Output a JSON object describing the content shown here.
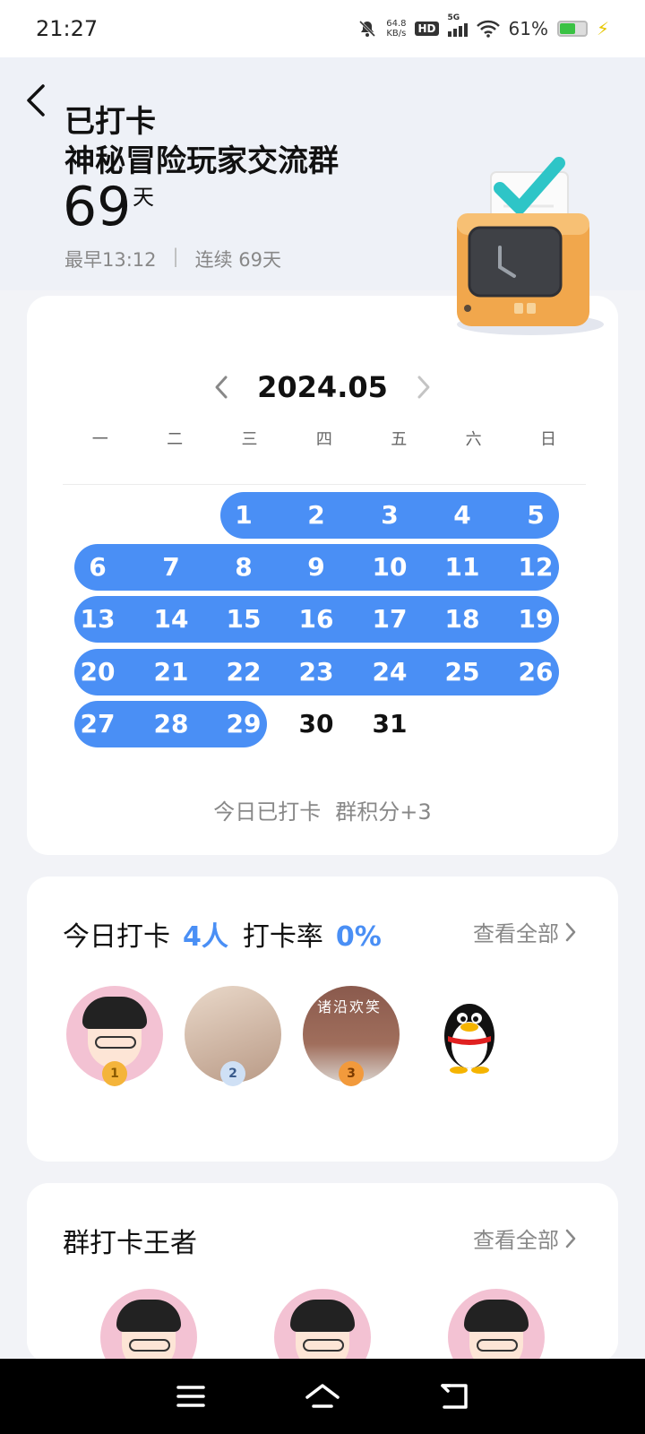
{
  "status_bar": {
    "time": "21:27",
    "net_speed_value": "64.8",
    "net_speed_unit": "KB/s",
    "hd_label": "HD",
    "network_label": "5G",
    "battery_percent": "61%",
    "icons": [
      "mute-bell-icon",
      "wifi-icon",
      "signal-icon",
      "battery-icon",
      "charging-bolt-icon"
    ]
  },
  "header": {
    "status_title": "已打卡",
    "group_name": "神秘冒险玩家交流群",
    "days_count": "69",
    "days_unit": "天",
    "earliest": "最早13:12",
    "separator": "|",
    "streak": "连续 69天"
  },
  "calendar": {
    "month": "2024.05",
    "weekdays": [
      "一",
      "二",
      "三",
      "四",
      "五",
      "六",
      "日"
    ],
    "first_weekday_index": 2,
    "days_in_month": 31,
    "checked_through_day": 29,
    "accent_color": "#4a8ff5",
    "today_status": "今日已打卡",
    "points": "群积分+3"
  },
  "today_checkin": {
    "label": "今日打卡",
    "count": "4人",
    "rate_label": "打卡率",
    "rate": "0%",
    "view_all": "查看全部",
    "avatars": [
      {
        "rank": "1",
        "icon": "cartoon-boy-avatar"
      },
      {
        "rank": "2",
        "icon": "girl-photo-avatar"
      },
      {
        "rank": "3",
        "icon": "child-photo-avatar",
        "watermark": "诸沿欢笑"
      },
      {
        "rank": "",
        "icon": "qq-penguin-avatar"
      }
    ]
  },
  "kings": {
    "title": "群打卡王者",
    "view_all": "查看全部"
  },
  "nav": {
    "icons": [
      "menu-icon",
      "home-icon",
      "back-icon"
    ]
  }
}
